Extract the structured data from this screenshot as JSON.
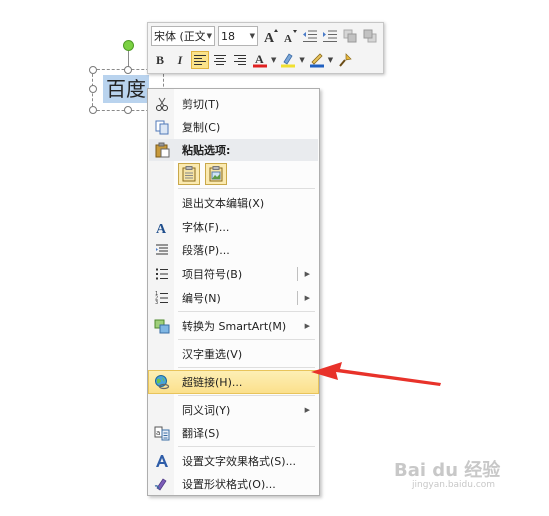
{
  "slide_text": "百度",
  "mini_toolbar": {
    "font_name": "宋体 (正文",
    "font_size": "18",
    "grow_font_icon": "grow-font-icon",
    "shrink_font_icon": "shrink-font-icon",
    "bold": "B",
    "italic": "I",
    "font_color": "#e02020",
    "highlight_color": "#f0e030",
    "underline_color": "#2060c0"
  },
  "menu": {
    "cut": {
      "label": "剪切(T)",
      "icon": "scissors-icon"
    },
    "copy": {
      "label": "复制(C)",
      "icon": "copy-icon"
    },
    "paste_options": {
      "label": "粘贴选项:",
      "icon": "paste-icon"
    },
    "exit_edit": {
      "label": "退出文本编辑(X)"
    },
    "font": {
      "label": "字体(F)...",
      "icon": "font-icon"
    },
    "paragraph": {
      "label": "段落(P)...",
      "icon": "paragraph-icon"
    },
    "bullets": {
      "label": "项目符号(B)",
      "icon": "bullets-icon"
    },
    "numbering": {
      "label": "编号(N)",
      "icon": "numbering-icon"
    },
    "smartart": {
      "label": "转换为 SmartArt(M)",
      "icon": "smartart-icon"
    },
    "reconvert": {
      "label": "汉字重选(V)"
    },
    "hyperlink": {
      "label": "超链接(H)...",
      "icon": "hyperlink-globe-icon"
    },
    "synonyms": {
      "label": "同义词(Y)"
    },
    "translate": {
      "label": "翻译(S)",
      "icon": "translate-icon"
    },
    "text_effects": {
      "label": "设置文字效果格式(S)...",
      "icon": "text-effects-icon"
    },
    "shape_format": {
      "label": "设置形状格式(O)...",
      "icon": "shape-format-icon"
    }
  },
  "annotation_color": "#e8322a",
  "watermark": {
    "main": "Bai du 经验",
    "sub": "jingyan.baidu.com"
  }
}
